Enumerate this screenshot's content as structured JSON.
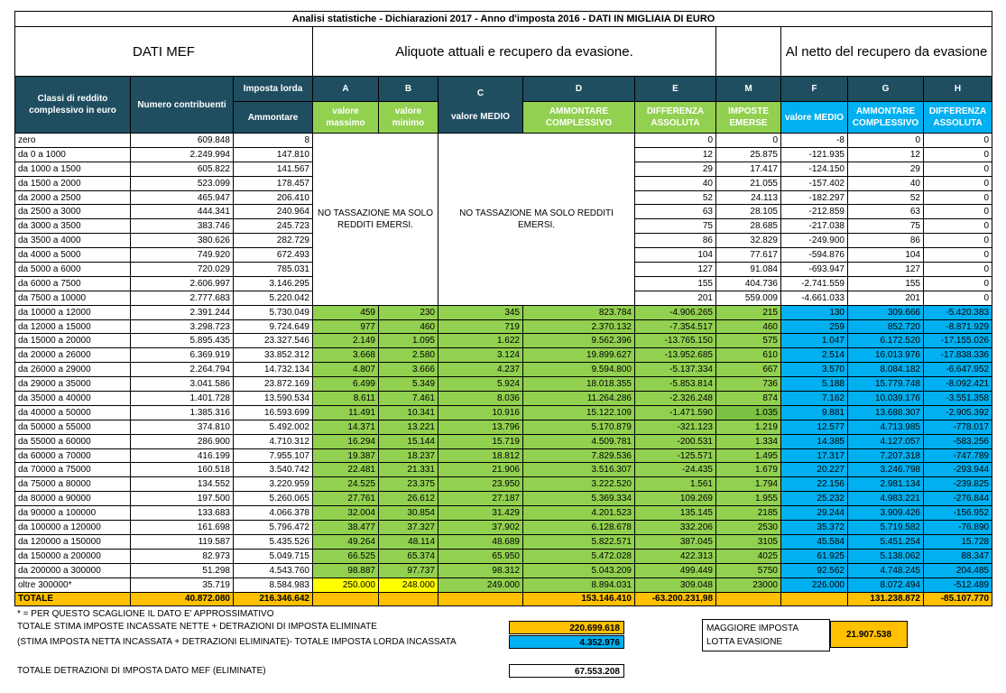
{
  "title": "Analisi statistiche - Dichiarazioni 2017 - Anno d'imposta 2016 - DATI IN MIGLIAIA DI EURO",
  "sections": {
    "mef": "DATI MEF",
    "aliquote": "Aliquote  attuali e recupero da evasione.",
    "netto": "Al netto del recupero da evasione"
  },
  "headers": {
    "classi": "Classi di reddito complessivo in euro",
    "numero": "Numero contribuenti",
    "imposta_lorda": "Imposta lorda",
    "ammontare": "Ammontare",
    "A": "A",
    "B": "B",
    "C": "C",
    "D": "D",
    "E": "E",
    "M": "M",
    "F": "F",
    "G": "G",
    "H": "H",
    "a_sub": "valore massimo",
    "b_sub": "valore minimo",
    "c_sub": "valore MEDIO",
    "d_sub": "AMMONTARE COMPLESSIVO",
    "e_sub": "DIFFERENZA ASSOLUTA",
    "m_sub": "IMPOSTE EMERSE",
    "f_sub": "valore MEDIO",
    "g_sub": "AMMONTARE COMPLESSIVO",
    "h_sub": "DIFFERENZA ASSOLUTA"
  },
  "no_tax_note": "NO TASSAZIONE MA SOLO REDDITI EMERSI.",
  "rows": [
    [
      "zero",
      "609.848",
      "8",
      "",
      "",
      "0",
      "0",
      "-8",
      "0",
      "0",
      "0",
      "-8"
    ],
    [
      "da 0 a 1000",
      "2.249.994",
      "147.810",
      "",
      "",
      "12",
      "25.875",
      "-121.935",
      "12",
      "0",
      "0",
      "-147.810"
    ],
    [
      "da 1000 a 1500",
      "605.822",
      "141.567",
      "",
      "",
      "29",
      "17.417",
      "-124.150",
      "29",
      "0",
      "0",
      "-141.567"
    ],
    [
      "da 1500 a 2000",
      "523.099",
      "178.457",
      "",
      "",
      "40",
      "21.055",
      "-157.402",
      "40",
      "0",
      "0",
      "-178.457"
    ],
    [
      "da 2000 a 2500",
      "465.947",
      "206.410",
      "",
      "",
      "52",
      "24.113",
      "-182.297",
      "52",
      "0",
      "0",
      "-206.410"
    ],
    [
      "da 2500 a 3000",
      "444.341",
      "240.964",
      "",
      "",
      "63",
      "28.105",
      "-212.859",
      "63",
      "0",
      "0",
      "-240.964"
    ],
    [
      "da 3000 a 3500",
      "383.746",
      "245.723",
      "",
      "",
      "75",
      "28.685",
      "-217.038",
      "75",
      "0",
      "0",
      "-245.723"
    ],
    [
      "da 3500 a 4000",
      "380.626",
      "282.729",
      "",
      "",
      "86",
      "32.829",
      "-249.900",
      "86",
      "0",
      "0",
      "-282.729"
    ],
    [
      "da 4000 a 5000",
      "749.920",
      "672.493",
      "",
      "",
      "104",
      "77.617",
      "-594.876",
      "104",
      "0",
      "0",
      "-672.493"
    ],
    [
      "da 5000 a 6000",
      "720.029",
      "785.031",
      "",
      "",
      "127",
      "91.084",
      "-693.947",
      "127",
      "0",
      "0",
      "-785.031"
    ],
    [
      "da 6000 a 7500",
      "2.606.997",
      "3.146.295",
      "",
      "",
      "155",
      "404.736",
      "-2.741.559",
      "155",
      "0",
      "0",
      "-3.146.295"
    ],
    [
      "da 7500 a 10000",
      "2.777.683",
      "5.220.042",
      "",
      "",
      "201",
      "559.009",
      "-4.661.033",
      "201",
      "0",
      "0",
      "-5.220.042"
    ],
    [
      "da 10000 a 12000",
      "2.391.244",
      "5.730.049",
      "459",
      "230",
      "345",
      "823.784",
      "-4.906.265",
      "215",
      "130",
      "309.666",
      "-5.420.383"
    ],
    [
      "da 12000 a 15000",
      "3.298.723",
      "9.724.649",
      "977",
      "460",
      "719",
      "2.370.132",
      "-7.354.517",
      "460",
      "259",
      "852.720",
      "-8.871.929"
    ],
    [
      "da 15000 a 20000",
      "5.895.435",
      "23.327.546",
      "2.149",
      "1.095",
      "1.622",
      "9.562.396",
      "-13.765.150",
      "575",
      "1.047",
      "6.172.520",
      "-17.155.026"
    ],
    [
      "da 20000 a 26000",
      "6.369.919",
      "33.852.312",
      "3.668",
      "2.580",
      "3.124",
      "19.899.627",
      "-13.952.685",
      "610",
      "2.514",
      "16.013.976",
      "-17.838.336"
    ],
    [
      "da 26000 a 29000",
      "2.264.794",
      "14.732.134",
      "4.807",
      "3.666",
      "4.237",
      "9.594.800",
      "-5.137.334",
      "667",
      "3.570",
      "8.084.182",
      "-6.647.952"
    ],
    [
      "da 29000 a 35000",
      "3.041.586",
      "23.872.169",
      "6.499",
      "5.349",
      "5.924",
      "18.018.355",
      "-5.853.814",
      "736",
      "5.188",
      "15.779.748",
      "-8.092.421"
    ],
    [
      "da 35000 a 40000",
      "1.401.728",
      "13.590.534",
      "8.611",
      "7.461",
      "8.036",
      "11.264.286",
      "-2.326.248",
      "874",
      "7.162",
      "10.039.176",
      "-3.551.358"
    ],
    [
      "da 40000 a 50000",
      "1.385.316",
      "16.593.699",
      "11.491",
      "10.341",
      "10.916",
      "15.122.109",
      "-1.471.590",
      "1.035",
      "9.881",
      "13.688.307",
      "-2.905.392"
    ],
    [
      "da 50000 a 55000",
      "374.810",
      "5.492.002",
      "14.371",
      "13.221",
      "13.796",
      "5.170.879",
      "-321.123",
      "1.219",
      "12.577",
      "4.713.985",
      "-778.017"
    ],
    [
      "da 55000 a 60000",
      "286.900",
      "4.710.312",
      "16.294",
      "15.144",
      "15.719",
      "4.509.781",
      "-200.531",
      "1.334",
      "14.385",
      "4.127.057",
      "-583.256"
    ],
    [
      "da 60000 a 70000",
      "416.199",
      "7.955.107",
      "19.387",
      "18.237",
      "18.812",
      "7.829.536",
      "-125.571",
      "1.495",
      "17.317",
      "7.207.318",
      "-747.789"
    ],
    [
      "da 70000 a 75000",
      "160.518",
      "3.540.742",
      "22.481",
      "21.331",
      "21.906",
      "3.516.307",
      "-24.435",
      "1.679",
      "20.227",
      "3.246.798",
      "-293.944"
    ],
    [
      "da 75000 a 80000",
      "134.552",
      "3.220.959",
      "24.525",
      "23.375",
      "23.950",
      "3.222.520",
      "1.561",
      "1.794",
      "22.156",
      "2.981.134",
      "-239.825"
    ],
    [
      "da 80000 a 90000",
      "197.500",
      "5.260.065",
      "27.761",
      "26.612",
      "27.187",
      "5.369.334",
      "109.269",
      "1.955",
      "25.232",
      "4.983.221",
      "-276.844"
    ],
    [
      "da 90000 a 100000",
      "133.683",
      "4.066.378",
      "32.004",
      "30.854",
      "31.429",
      "4.201.523",
      "135.145",
      "2185",
      "29.244",
      "3.909.426",
      "-156.952"
    ],
    [
      "da 100000 a 120000",
      "161.698",
      "5.796.472",
      "38.477",
      "37.327",
      "37.902",
      "6.128.678",
      "332.206",
      "2530",
      "35.372",
      "5.719.582",
      "-76.890"
    ],
    [
      "da 120000 a 150000",
      "119.587",
      "5.435.526",
      "49.264",
      "48.114",
      "48.689",
      "5.822.571",
      "387.045",
      "3105",
      "45.584",
      "5.451.254",
      "15.728"
    ],
    [
      "da 150000 a 200000",
      "82.973",
      "5.049.715",
      "66.525",
      "65.374",
      "65.950",
      "5.472.028",
      "422.313",
      "4025",
      "61.925",
      "5.138.062",
      "88.347"
    ],
    [
      "da 200000 a 300000",
      "51.298",
      "4.543.760",
      "98.887",
      "97.737",
      "98.312",
      "5.043.209",
      "499.449",
      "5750",
      "92.562",
      "4.748.245",
      "204.485"
    ],
    [
      "oltre 300000*",
      "35.719",
      "8.584.983",
      "250.000",
      "248.000",
      "249.000",
      "8.894.031",
      "309.048",
      "23000",
      "226.000",
      "8.072.494",
      "-512.489"
    ]
  ],
  "totals": {
    "label": "TOTALE",
    "numero": "40.872.080",
    "ammontare": "216.346.642",
    "d": "153.146.410",
    "e": "-63.200.231,98",
    "g": "131.238.872",
    "h": "-85.107.770"
  },
  "notes": {
    "asterisk": "* = PER QUESTO SCAGLIONE IL DATO E' APPROSSIMATIVO",
    "stima": "TOTALE STIMA IMPOSTE INCASSATE NETTE  + DETRAZIONI DI IMPOSTA ELIMINATE",
    "stima_value": "220.699.618",
    "diff": "(STIMA IMPOSTA NETTA INCASSATA + DETRAZIONI ELIMINATE)- TOTALE IMPOSTA LORDA INCASSATA",
    "diff_value": "4.352.976",
    "detrazioni": "TOTALE DETRAZIONI DI IMPOSTA DATO MEF (ELIMINATE)",
    "detrazioni_value": "67.553.208",
    "maggiore_1": "MAGGIORE IMPOSTA",
    "maggiore_2": "LOTTA EVASIONE",
    "maggiore_value": "21.907.538"
  },
  "colors": {
    "header_dark": "#1f4e61",
    "green": "#92d050",
    "blue": "#00b0f0",
    "yellow": "#ffff00",
    "orange": "#ffc000"
  }
}
